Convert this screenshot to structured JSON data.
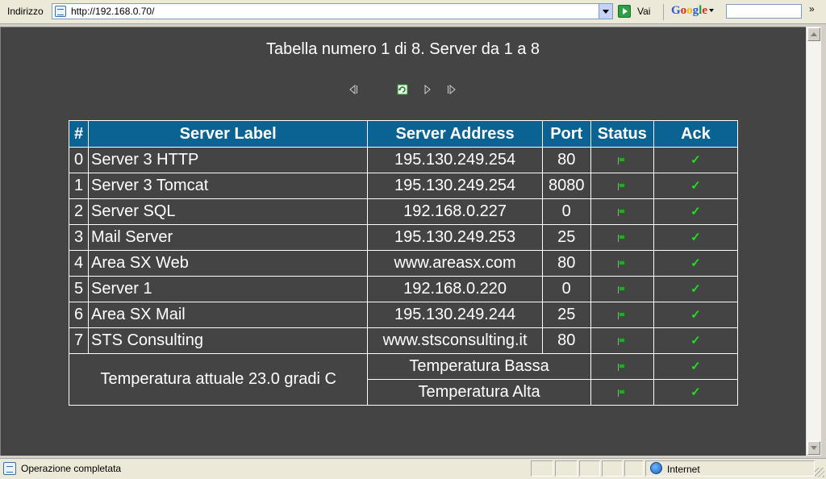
{
  "toolbar": {
    "address_label": "Indirizzo",
    "address_value": "http://192.168.0.70/",
    "go_label": "Vai",
    "google_label": "Google"
  },
  "page": {
    "title": "Tabella numero 1 di 8. Server da 1 a 8"
  },
  "table": {
    "headers": [
      "#",
      "Server Label",
      "Server Address",
      "Port",
      "Status",
      "Ack"
    ],
    "rows": [
      {
        "num": "0",
        "label": "Server 3 HTTP",
        "address": "195.130.249.254",
        "port": "80"
      },
      {
        "num": "1",
        "label": "Server 3 Tomcat",
        "address": "195.130.249.254",
        "port": "8080"
      },
      {
        "num": "2",
        "label": "Server SQL",
        "address": "192.168.0.227",
        "port": "0"
      },
      {
        "num": "3",
        "label": "Mail Server",
        "address": "195.130.249.253",
        "port": "25"
      },
      {
        "num": "4",
        "label": "Area SX Web",
        "address": "www.areasx.com",
        "port": "80"
      },
      {
        "num": "5",
        "label": "Server 1",
        "address": "192.168.0.220",
        "port": "0"
      },
      {
        "num": "6",
        "label": "Area SX Mail",
        "address": "195.130.249.244",
        "port": "25"
      },
      {
        "num": "7",
        "label": "STS Consulting",
        "address": "www.stsconsulting.it",
        "port": "80"
      }
    ],
    "temperature": {
      "current": "Temperatura attuale 23.0 gradi C",
      "low": "Temperatura Bassa",
      "high": "Temperatura Alta"
    },
    "status_icon": "green-flag-icon",
    "ack_icon": "green-check-icon",
    "header_color": "#0b6394",
    "background_color": "#444444"
  },
  "statusbar": {
    "message": "Operazione completata",
    "zone": "Internet"
  }
}
